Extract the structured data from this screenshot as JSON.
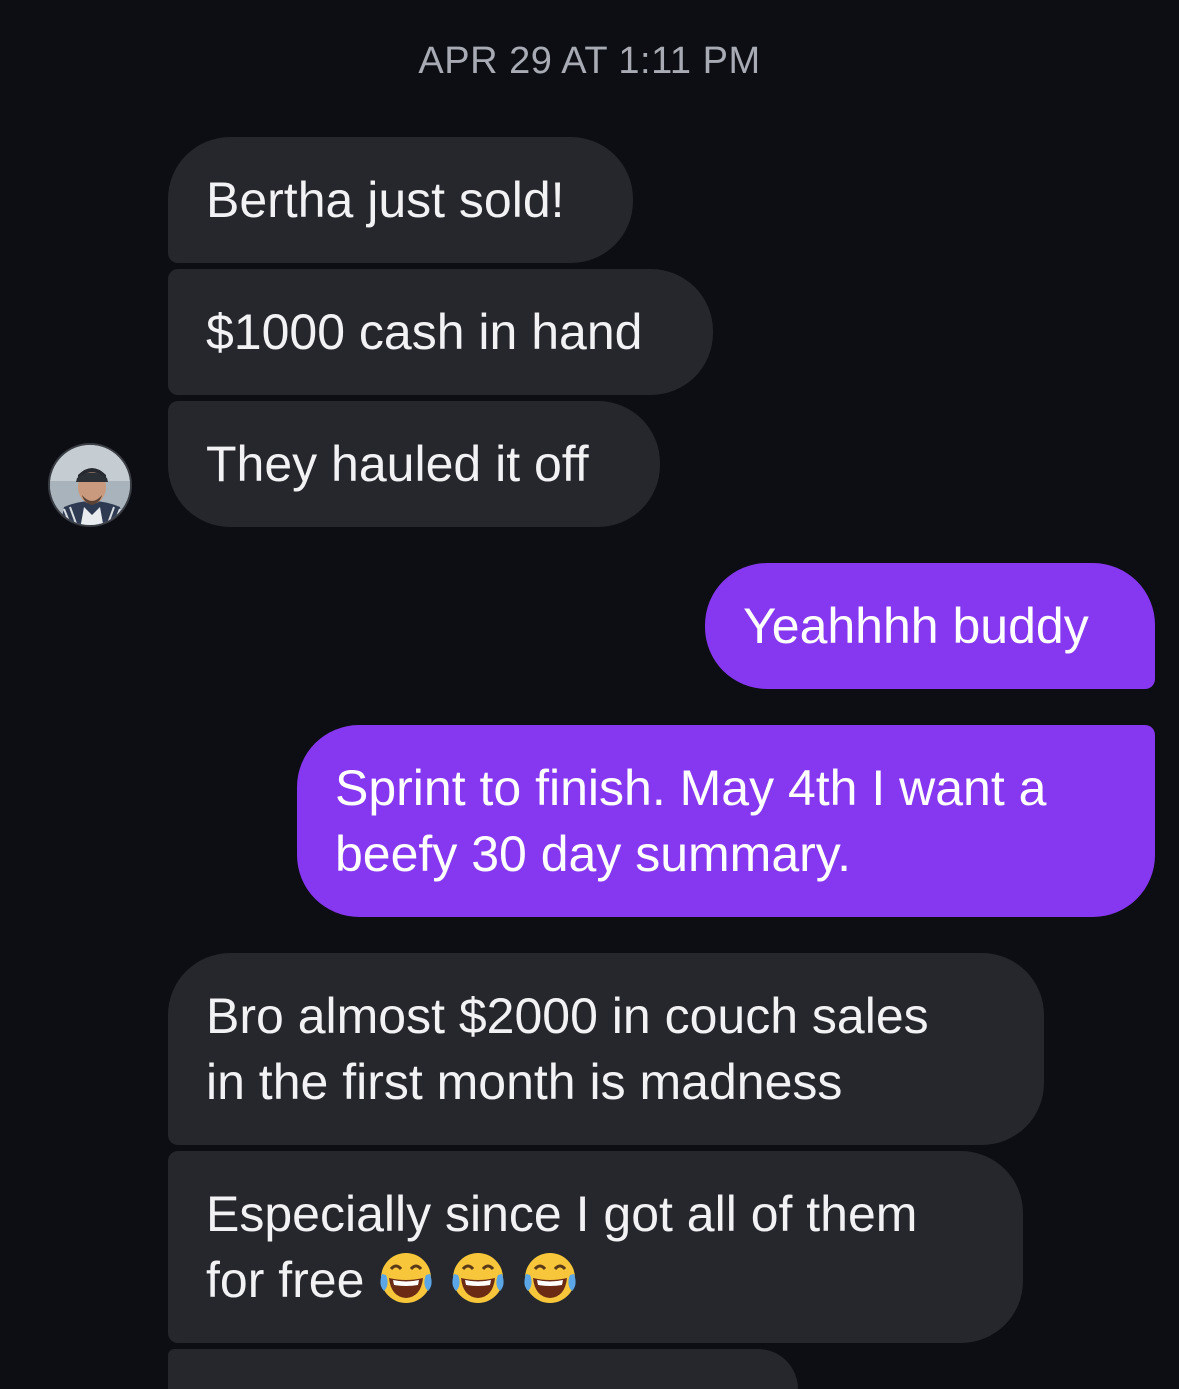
{
  "thread": {
    "timestamp": "APR 29 AT 1:11 PM"
  },
  "messages": [
    {
      "from": "them",
      "text": "Bertha just sold!"
    },
    {
      "from": "them",
      "text": "$1000 cash in hand"
    },
    {
      "from": "them",
      "text": "They hauled it off"
    },
    {
      "from": "me",
      "text": "Yeahhhh buddy"
    },
    {
      "from": "me",
      "line1": "Sprint to finish. May 4th I want a",
      "line2": "beefy 30 day summary."
    },
    {
      "from": "them",
      "line1": "Bro almost $2000 in couch sales",
      "line2": "in the first month is madness"
    },
    {
      "from": "them",
      "line1": "Especially since I got all of them",
      "line2": "for free",
      "emojis": [
        "face-with-tears-of-joy-icon",
        "face-with-tears-of-joy-icon",
        "face-with-tears-of-joy-icon"
      ]
    }
  ],
  "colors": {
    "background": "#0c0e13",
    "incoming_bubble": "#25272d",
    "outgoing_bubble": "#8637f0",
    "timestamp_text": "#a8abb3"
  },
  "icons": {
    "avatar": "contact-avatar",
    "emoji": "face-with-tears-of-joy-icon"
  }
}
